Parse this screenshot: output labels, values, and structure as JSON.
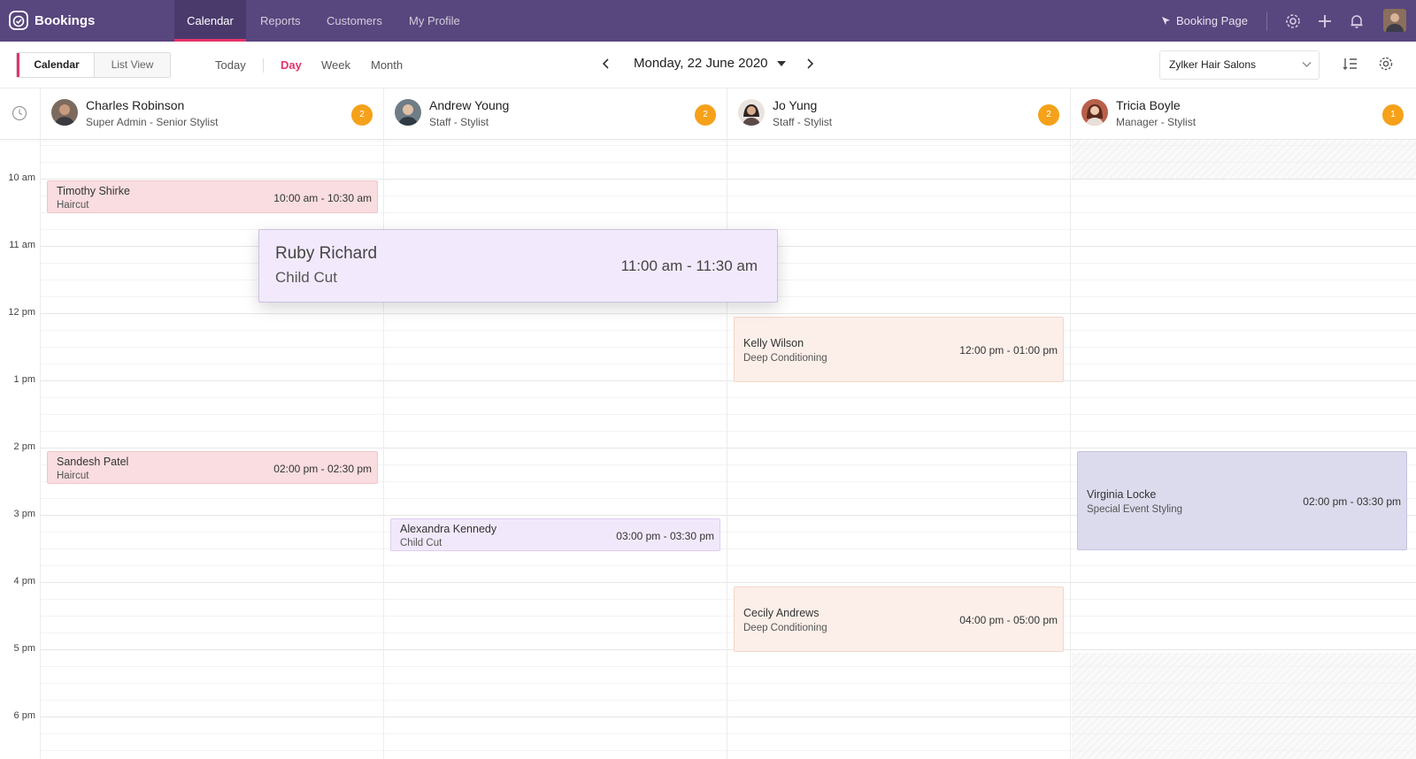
{
  "app": {
    "brand": "Bookings",
    "nav_tabs": [
      {
        "label": "Calendar",
        "active": true
      },
      {
        "label": "Reports",
        "active": false
      },
      {
        "label": "Customers",
        "active": false
      },
      {
        "label": "My Profile",
        "active": false
      }
    ],
    "booking_page_label": "Booking Page",
    "accent_color": "#e8336a",
    "header_color": "#58467e"
  },
  "toolbar": {
    "view_toggle": [
      "Calendar",
      "List View"
    ],
    "today_label": "Today",
    "ranges": [
      "Day",
      "Week",
      "Month"
    ],
    "active_range": "Day",
    "current_date": "Monday, 22 June 2020",
    "organization": "Zylker Hair Salons"
  },
  "time_labels": [
    "10 am",
    "11 am",
    "12 pm",
    "1 pm",
    "2 pm",
    "3 pm",
    "4 pm",
    "5 pm",
    "6 pm"
  ],
  "staff": [
    {
      "name": "Charles Robinson",
      "role": "Super Admin - Senior Stylist",
      "count": "2"
    },
    {
      "name": "Andrew Young",
      "role": "Staff - Stylist",
      "count": "2"
    },
    {
      "name": "Jo Yung",
      "role": "Staff - Stylist",
      "count": "2"
    },
    {
      "name": "Tricia Boyle",
      "role": "Manager - Stylist",
      "count": "1"
    }
  ],
  "appointments": [
    {
      "customer": "Timothy Shirke",
      "service": "Haircut",
      "time": "10:00 am - 10:30 am"
    },
    {
      "customer": "Sandesh Patel",
      "service": "Haircut",
      "time": "02:00 pm - 02:30 pm"
    },
    {
      "customer": "Alexandra Kennedy",
      "service": "Child Cut",
      "time": "03:00 pm - 03:30 pm"
    },
    {
      "customer": "Kelly Wilson",
      "service": "Deep Conditioning",
      "time": "12:00 pm - 01:00 pm"
    },
    {
      "customer": "Cecily Andrews",
      "service": "Deep Conditioning",
      "time": "04:00 pm - 05:00 pm"
    },
    {
      "customer": "Virginia Locke",
      "service": "Special Event Styling",
      "time": "02:00 pm - 03:30 pm"
    }
  ],
  "dragging_appointment": {
    "customer": "Ruby Richard",
    "service": "Child Cut",
    "time": "11:00 am - 11:30 am"
  }
}
